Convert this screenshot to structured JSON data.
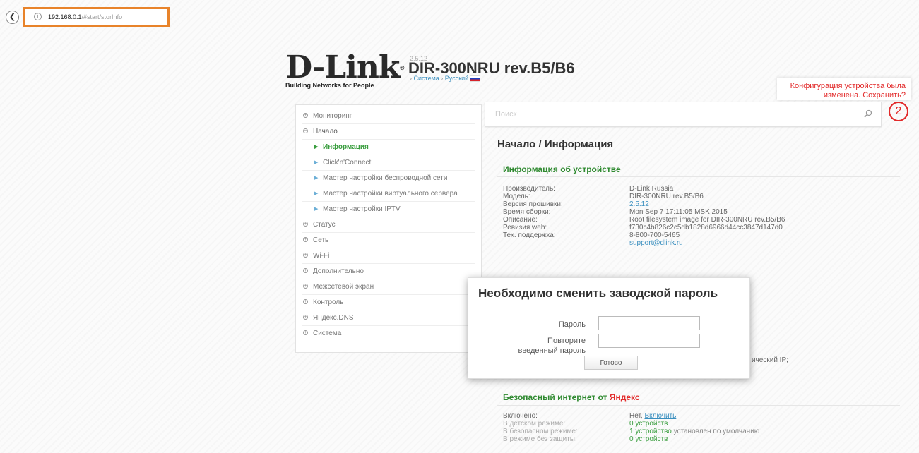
{
  "browser": {
    "url_host": "192.168.0.1",
    "url_path": "/#start/storInfo"
  },
  "header": {
    "logo_text": "D-Link",
    "logo_tagline": "Building Networks for People",
    "firmware_small": "2.5.12",
    "model": "DIR-300NRU rev.B5/B6",
    "link_system": "Система",
    "link_language": "Русский",
    "notification": "Конфигурация устройства была изменена. Сохранить?"
  },
  "search": {
    "placeholder": "Поиск",
    "notification_count": "2"
  },
  "sidebar": {
    "items": [
      {
        "label": "Мониторинг"
      },
      {
        "label": "Начало"
      },
      {
        "label": "Информация"
      },
      {
        "label": "Click'n'Connect"
      },
      {
        "label": "Мастер настройки беспроводной сети"
      },
      {
        "label": "Мастер настройки виртуального сервера"
      },
      {
        "label": "Мастер настройки IPTV"
      },
      {
        "label": "Статус"
      },
      {
        "label": "Сеть"
      },
      {
        "label": "Wi-Fi"
      },
      {
        "label": "Дополнительно"
      },
      {
        "label": "Межсетевой экран"
      },
      {
        "label": "Контроль"
      },
      {
        "label": "Яндекс.DNS"
      },
      {
        "label": "Система"
      }
    ]
  },
  "main": {
    "page_title": "Начало /  Информация",
    "device_info": {
      "title": "Информация об устройстве",
      "rows": [
        {
          "label": "Производитель:",
          "value": "D-Link Russia"
        },
        {
          "label": "Модель:",
          "value": "DIR-300NRU rev.B5/B6"
        },
        {
          "label": "Версия прошивки:",
          "value": "2.5.12"
        },
        {
          "label": "Время сборки:",
          "value": "Mon Sep 7 17:11:05 MSK 2015"
        },
        {
          "label": "Описание:",
          "value": "Root filesystem image for DIR-300NRU rev.B5/B6"
        },
        {
          "label": "Ревизия web:",
          "value": "f730c4b826c2c5db1828d6966d44cc3847d147d0"
        },
        {
          "label": "Тех. поддержка:",
          "value": "8-800-700-5465"
        },
        {
          "label": "",
          "value": "support@dlink.ru"
        }
      ]
    },
    "peek_text": "ический IP;",
    "yandex": {
      "title_prefix": "Безопасный интернет от ",
      "title_brand": "Яндекс",
      "enabled_label": "Включено:",
      "enabled_value": "Нет,",
      "enabled_link": "Включить",
      "rows": [
        {
          "label": "В детском режиме:",
          "count": "0 устройств",
          "note": ""
        },
        {
          "label": "В безопасном режиме:",
          "count": "1 устройство",
          "note": " установлен по умолчанию"
        },
        {
          "label": "В режиме без защиты:",
          "count": "0 устройств",
          "note": ""
        }
      ]
    }
  },
  "modal": {
    "title": "Необходимо сменить заводской пароль",
    "password_label": "Пароль",
    "repeat_label_line1": "Повторите",
    "repeat_label_line2": "введенный пароль",
    "button_label": "Готово"
  }
}
